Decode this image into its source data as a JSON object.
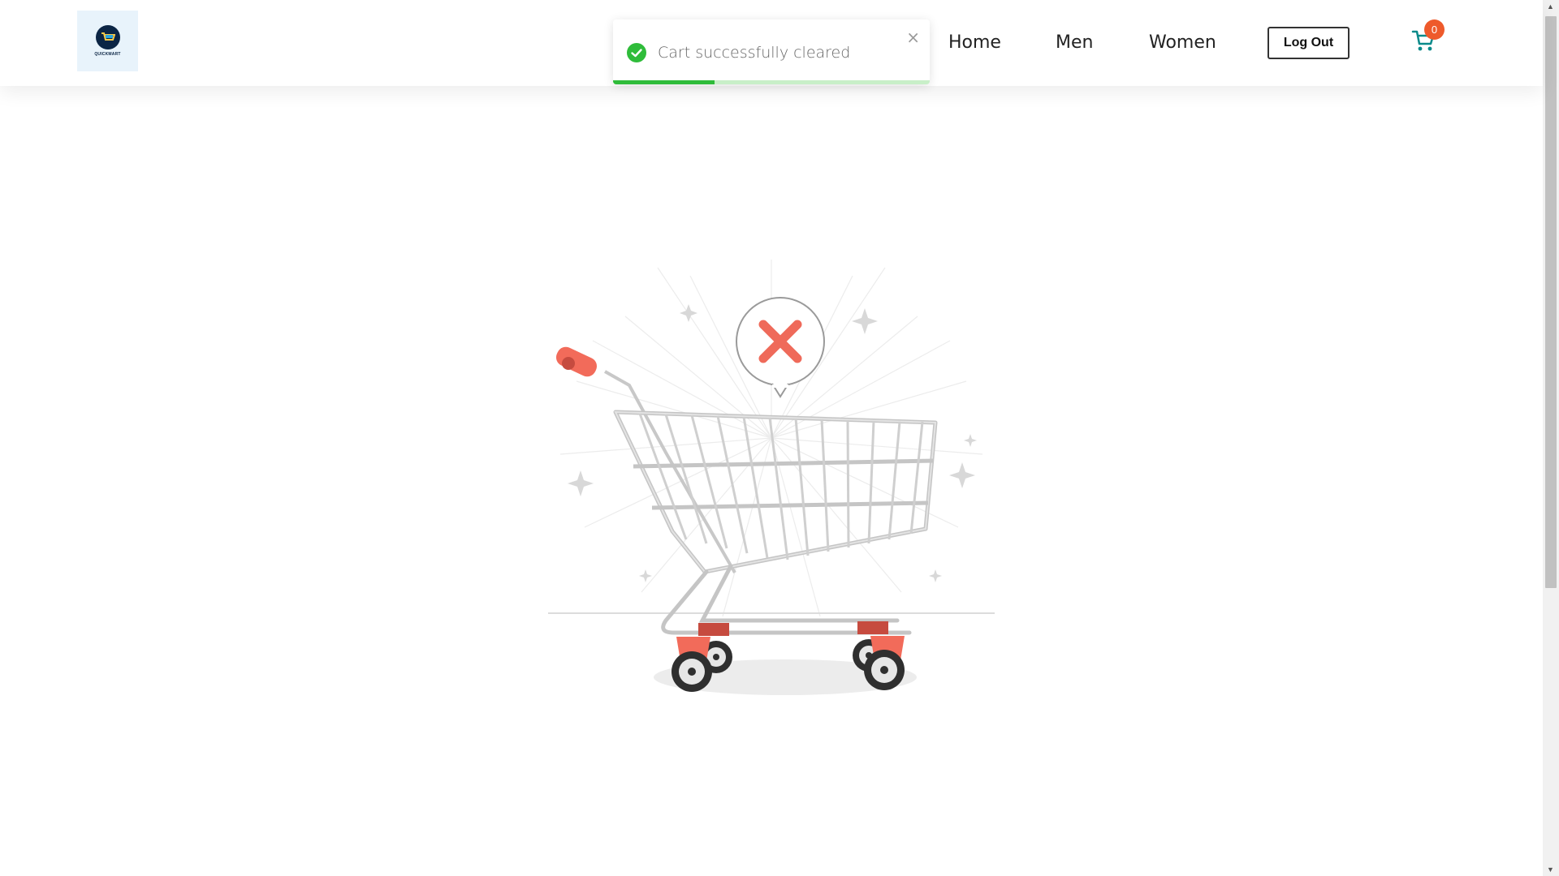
{
  "header": {
    "logo_text": "QUICKMART",
    "nav": [
      "Home",
      "Men",
      "Women"
    ],
    "logout_label": "Log Out",
    "cart_count": "0"
  },
  "toast": {
    "message": "Cart successfully cleared",
    "close_symbol": "×",
    "progress": 0.32
  },
  "icons": {
    "cart": "shopping-cart-icon",
    "toast_status": "check-circle-icon",
    "empty_state": "empty-cart-x-icon"
  },
  "colors": {
    "accent": "#ee5a2b",
    "cart_icon": "#0a8a8a",
    "success": "#2fbc3a",
    "cart_handle": "#f26b5a"
  }
}
